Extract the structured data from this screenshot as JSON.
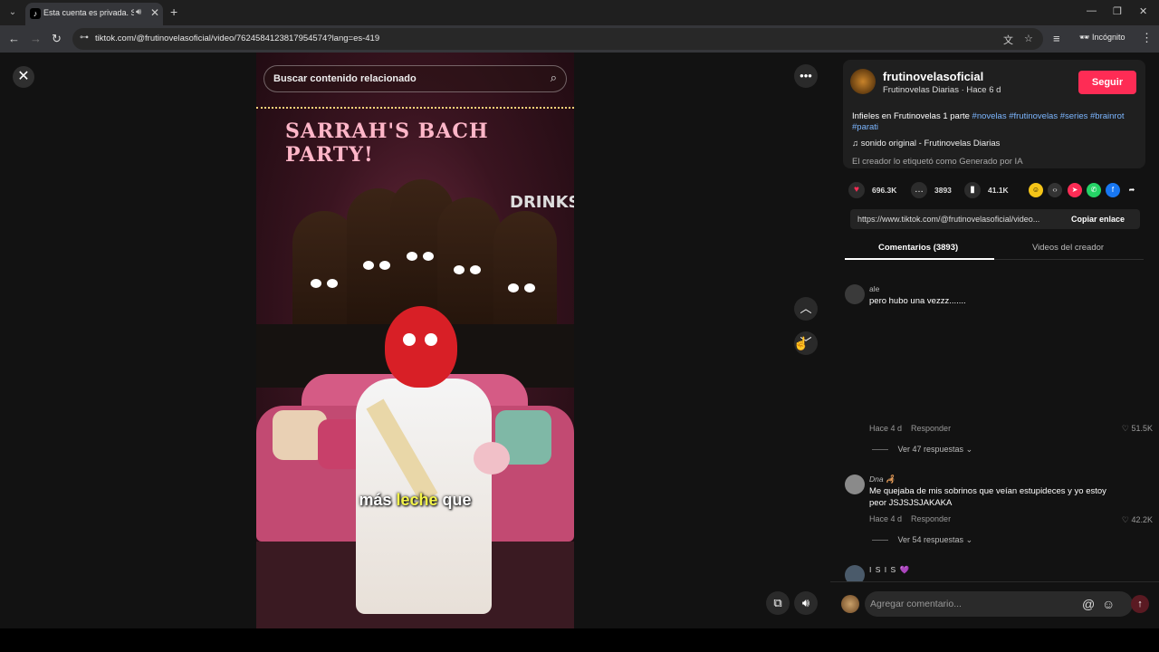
{
  "browser": {
    "tab_title": "Esta cuenta es privada. Sig",
    "url": "tiktok.com/@frutinovelasoficial/video/7624584123817954574?lang=es-419",
    "incognito_label": "Incógnito"
  },
  "video": {
    "search_placeholder": "Buscar contenido relacionado",
    "banner_text": "SARRAH'S BACH PARTY!",
    "drinks_sign": "DRINKS",
    "caption_before": "más ",
    "caption_highlight": "leche",
    "caption_after": " que"
  },
  "post": {
    "username": "frutinovelasoficial",
    "subline": "Frutinovelas Diarias · Hace 6 d",
    "follow_label": "Seguir",
    "description_text": "Infieles en Frutinovelas 1 parte ",
    "hashtags": [
      "#novelas",
      "#frutinovelas",
      "#series",
      "#brainrot",
      "#parati"
    ],
    "sound": "sonido original - Frutinovelas Diarias",
    "ai_label": "El creador lo etiquetó como Generado por IA",
    "likes": "696.3K",
    "comments_count": "3893",
    "saves": "41.1K",
    "share_link": "https://www.tiktok.com/@frutinovelasoficial/video...",
    "copy_link_label": "Copiar enlace"
  },
  "tabs": {
    "comments": "Comentarios (3893)",
    "creator_videos": "Videos del creador"
  },
  "comments": [
    {
      "user": "ale",
      "text": "pero hubo una vezzz.......",
      "age": "Hace 4 d",
      "reply": "Responder",
      "likes": "51.5K",
      "replies": "Ver 47 respuestas"
    },
    {
      "user": "Dna 🦂",
      "text": "Me quejaba de mis sobrinos que veían estupideces y yo estoy peor JSJSJSJAKAKA",
      "age": "Hace 4 d",
      "reply": "Responder",
      "likes": "42.2K",
      "replies": "Ver 54 respuestas"
    },
    {
      "user": "I S I S 💜"
    }
  ],
  "add_comment_placeholder": "Agregar comentario..."
}
